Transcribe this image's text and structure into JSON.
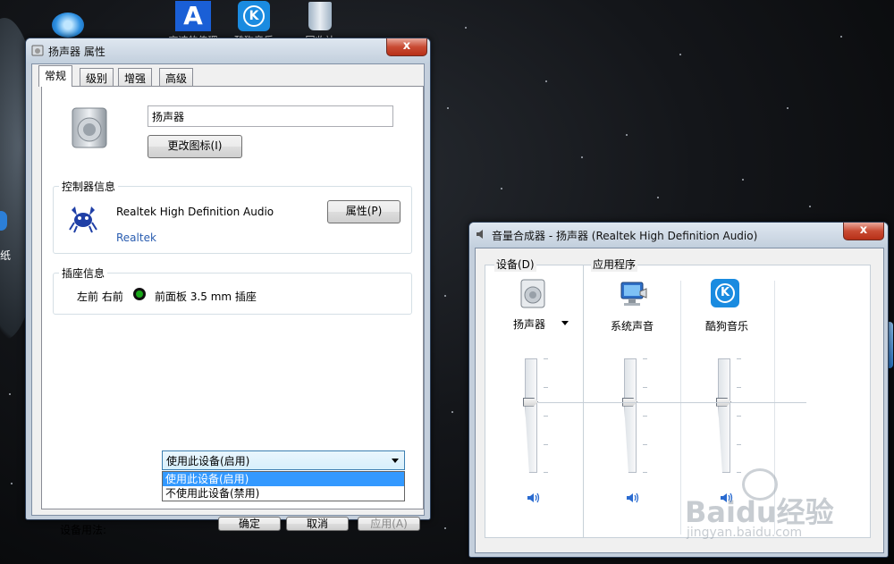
{
  "desktop": {
    "icons": [
      {
        "label": "高速的传理"
      },
      {
        "label": "酷狗音乐"
      },
      {
        "label": "回收站"
      }
    ],
    "left_text": "纸"
  },
  "properties_window": {
    "title": "扬声器 属性",
    "close_label": "x",
    "tabs": [
      {
        "label": "常规"
      },
      {
        "label": "级别"
      },
      {
        "label": "增强"
      },
      {
        "label": "高级"
      }
    ],
    "device_name_value": "扬声器",
    "change_icon_label": "更改图标(I)",
    "controller_group_label": "控制器信息",
    "controller_name": "Realtek High Definition Audio",
    "controller_vendor": "Realtek",
    "controller_properties_label": "属性(P)",
    "jack_group_label": "插座信息",
    "jack_channels": "左前 右前",
    "jack_description": "前面板 3.5 mm 插座",
    "jack_color": "#1aa81a",
    "usage_label": "设备用法:",
    "usage_selected": "使用此设备(启用)",
    "usage_options": [
      "使用此设备(启用)",
      "不使用此设备(禁用)"
    ],
    "ok_label": "确定",
    "cancel_label": "取消",
    "apply_label": "应用(A)"
  },
  "mixer_window": {
    "title": "音量合成器 - 扬声器 (Realtek High Definition Audio)",
    "close_label": "x",
    "device_section_label": "设备(D)",
    "apps_section_label": "应用程序",
    "channels": [
      {
        "name": "扬声器",
        "icon": "speaker-icon",
        "level": 0.62
      },
      {
        "name": "系统声音",
        "icon": "system-sounds-icon",
        "level": 0.62
      },
      {
        "name": "酷狗音乐",
        "icon": "kugou-icon",
        "level": 0.62
      }
    ]
  },
  "watermark": {
    "brand": "Baidu经验",
    "url": "jingyan.baidu.com"
  }
}
